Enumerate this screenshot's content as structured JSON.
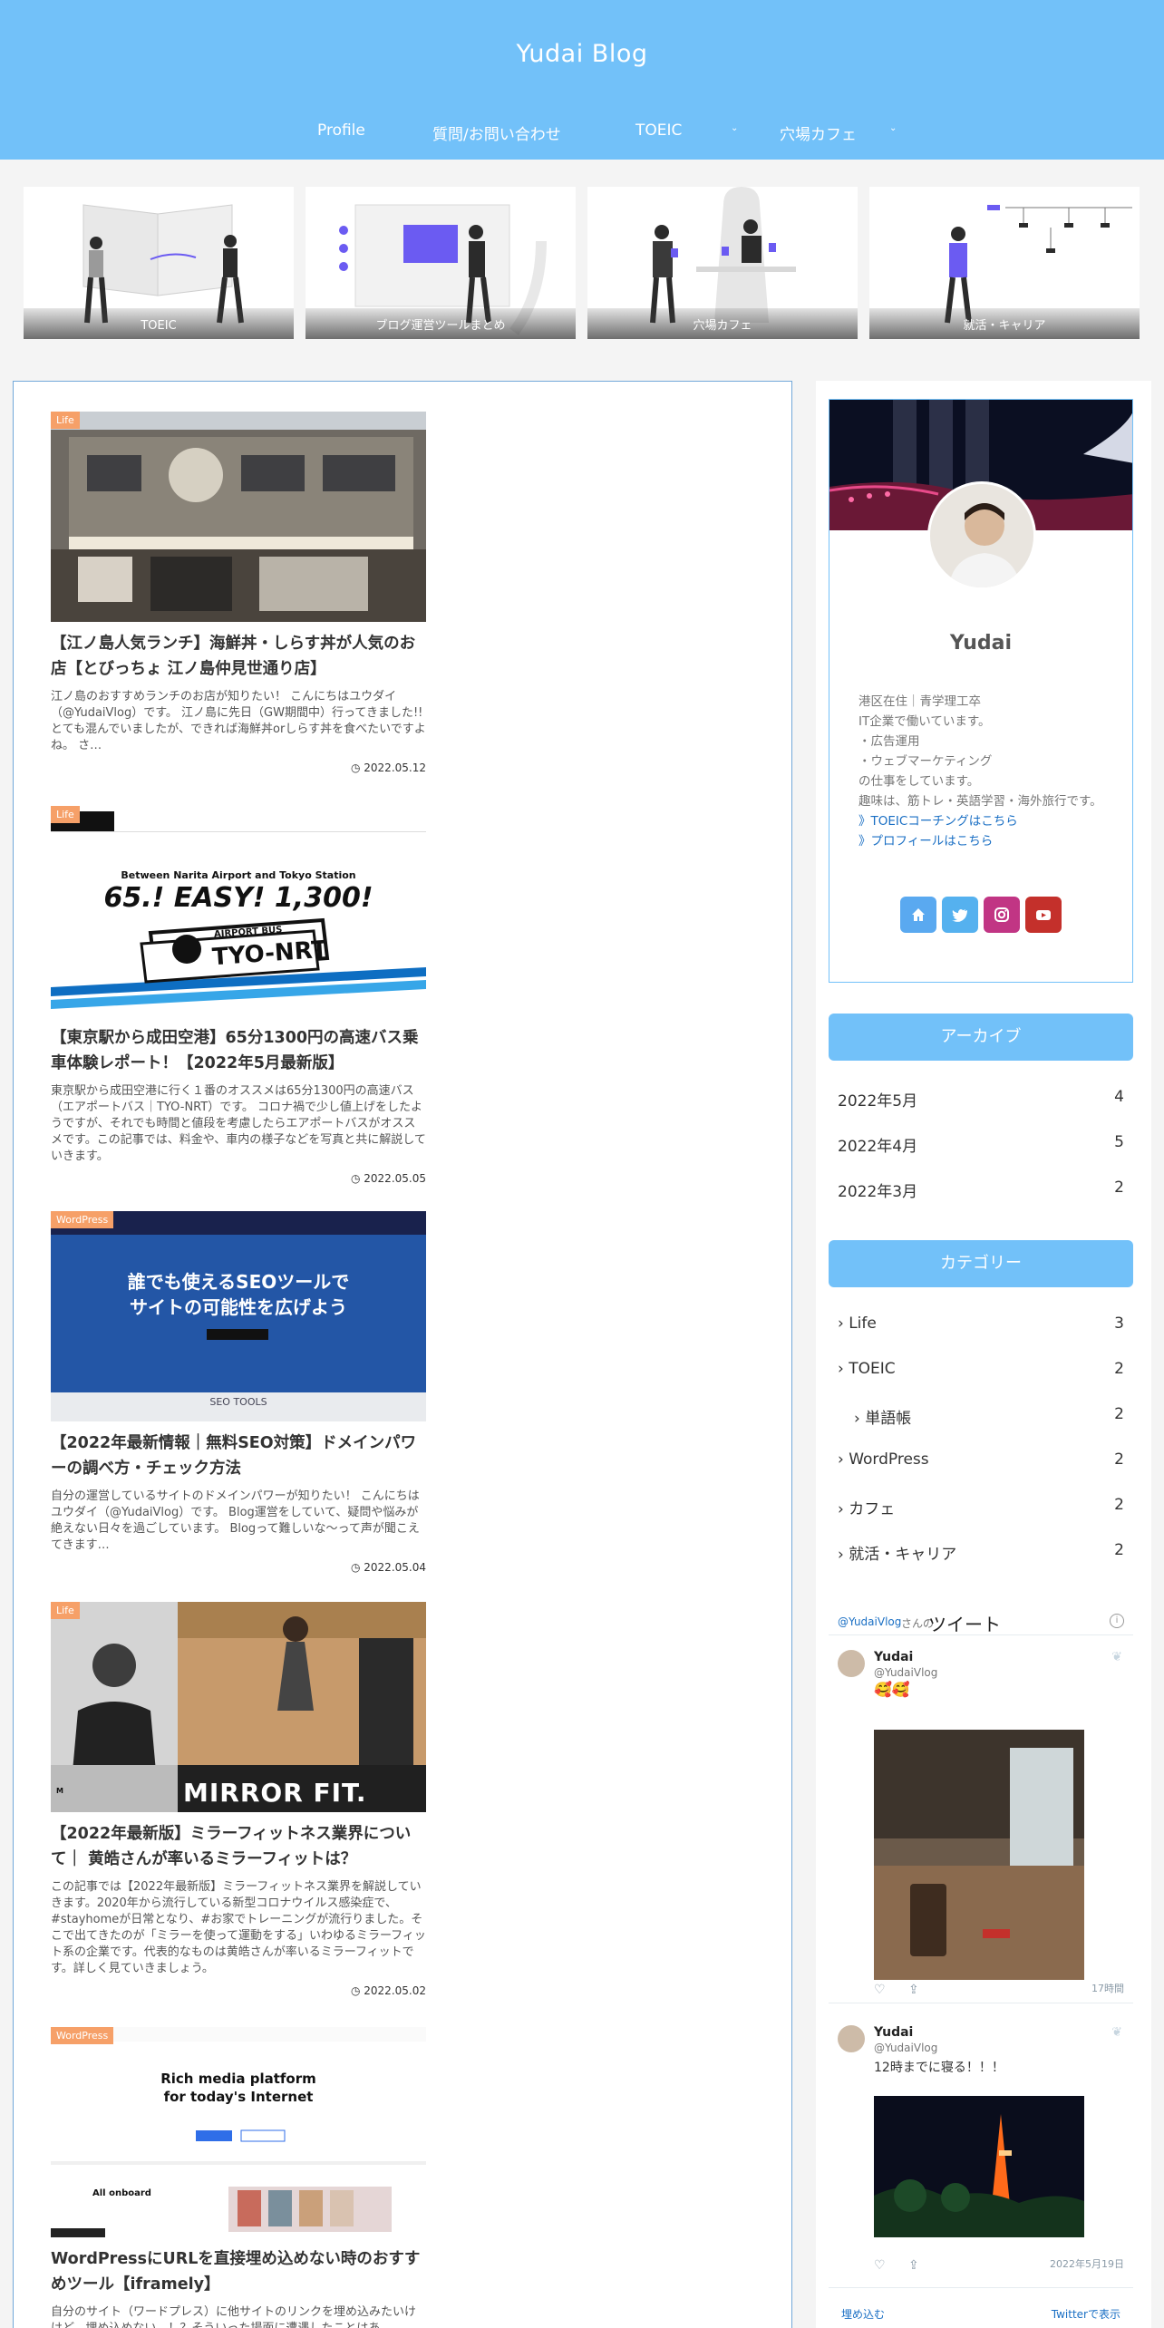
{
  "site": {
    "title": "Yudai Blog"
  },
  "nav": [
    {
      "label": "Profile"
    },
    {
      "label": "質問/お問い合わせ"
    },
    {
      "label": "TOEIC"
    },
    {
      "label": "穴場カフェ"
    }
  ],
  "carousel": [
    {
      "label": "TOEIC"
    },
    {
      "label": "ブログ運営ツールまとめ"
    },
    {
      "label": "穴場カフェ"
    },
    {
      "label": "就活・キャリア"
    }
  ],
  "posts": [
    {
      "category": "Life",
      "title": "【江ノ島人気ランチ】海鮮丼・しらす丼が人気のお店【とびっちょ 江ノ島仲見世通り店】",
      "excerpt": "江ノ島のおすすめランチのお店が知りたい！ こんにちはユウダイ（@YudaiVlog）です。 江ノ島に先日（GW期間中）行ってきました!!とても混んでいましたが、できれば海鮮丼orしらす丼を食べたいですよね。 さ…",
      "date": "2022.05.12"
    },
    {
      "category": "Life",
      "title": "【東京駅から成田空港】65分1300円の高速バス乗車体験レポート！【2022年5月最新版】",
      "excerpt": "東京駅から成田空港に行く１番のオススメは65分1300円の高速バス（エアポートバス｜TYO-NRT）です。 コロナ禍で少し値上げをしたようですが、それでも時間と値段を考慮したらエアポートバスがオススメです。この記事では、料金や、車内の様子などを写真と共に解説していきます。",
      "date": "2022.05.05",
      "thumb_text": {
        "tagline": "Between Narita Airport and Tokyo Station",
        "headline": "65.! EASY! 1,300!",
        "small": "AIRPORT BUS",
        "brand": "TYO-NRT"
      }
    },
    {
      "category": "WordPress",
      "title": "【2022年最新情報｜無料SEO対策】ドメインパワーの調べ方・チェック方法",
      "excerpt": "自分の運営しているサイトのドメインパワーが知りたい！ こんにちはユウダイ（@YudaiVlog）です。 Blog運営をしていて、疑問や悩みが絶えない日々を過ごしています。 Blogって難しいな〜って声が聞こえてきます…",
      "date": "2022.05.04",
      "thumb_text": {
        "line1": "誰でも使えるSEOツールで",
        "line2": "サイトの可能性を広げよう",
        "footer": "SEO TOOLS"
      }
    },
    {
      "category": "Life",
      "title": "【2022年最新版】ミラーフィットネス業界について｜ 黄皓さんが率いるミラーフィットは？",
      "excerpt": "この記事では【2022年最新版】ミラーフィットネス業界を解説していきます。2020年から流行している新型コロナウイルス感染症で、#stayhomeが日常となり、#お家でトレーニングが流行りました。そこで出てきたのが「ミラーを使って運動をする」いわゆるミラーフィット系の企業です。代表的なものは黄皓さんが率いるミラーフィットです。詳しく見ていきましょう。",
      "date": "2022.05.02",
      "thumb_text": {
        "brand": "MIRROR FIT."
      }
    },
    {
      "category": "WordPress",
      "title": "WordPressにURLを直接埋め込めない時のおすすめツール【iframely】",
      "excerpt": "自分のサイト（ワードプレス）に他サイトのリンクを埋め込みたいけけど、埋め込めない…！？そういった場面に遭遇したことはあ",
      "date": "",
      "thumb_text": {
        "headline1": "Rich media platform",
        "headline2": "for today's Internet",
        "sub": "All onboard"
      }
    }
  ],
  "profile": {
    "name": "Yudai",
    "lines": [
      "港区在住｜青学理工卒",
      "IT企業で働いています。",
      "・広告運用",
      "・ウェブマーケティング",
      "の仕事をしています。",
      "趣味は、筋トレ・英語学習・海外旅行です。"
    ],
    "links": [
      "》TOEICコーチングはこちら",
      "》プロフィールはこちら"
    ],
    "social": [
      {
        "icon": "home-icon",
        "color": "#5aa9f0"
      },
      {
        "icon": "twitter-icon",
        "color": "#55b1ef"
      },
      {
        "icon": "instagram-icon",
        "color": "#c13584"
      },
      {
        "icon": "youtube-icon",
        "color": "#c4302b"
      }
    ]
  },
  "archive": {
    "title": "アーカイブ",
    "items": [
      {
        "label": "2022年5月",
        "count": "4"
      },
      {
        "label": "2022年4月",
        "count": "5"
      },
      {
        "label": "2022年3月",
        "count": "2"
      }
    ]
  },
  "categories": {
    "title": "カテゴリー",
    "items": [
      {
        "label": "Life",
        "count": "3"
      },
      {
        "label": "TOEIC",
        "count": "2"
      },
      {
        "label": "単語帳",
        "count": "2"
      },
      {
        "label": "WordPress",
        "count": "2"
      },
      {
        "label": "カフェ",
        "count": "2"
      },
      {
        "label": "就活・キャリア",
        "count": "2"
      }
    ]
  },
  "twitter": {
    "handle_link": "@YudaiVlog",
    "suffix": "さんの",
    "heading": "ツイート",
    "tweets": [
      {
        "name": "Yudai",
        "handle": "@YudaiVlog",
        "text": "🥰🥰",
        "time": "17時間"
      },
      {
        "name": "Yudai",
        "handle": "@YudaiVlog",
        "text": "12時までに寝る！！！",
        "time": "2022年5月19日"
      }
    ],
    "footer_embed": "埋め込む",
    "footer_view": "Twitterで表示"
  },
  "colors": {
    "header": "#72c1f9",
    "badge": "#f6a068",
    "link": "#1a6fc4"
  }
}
